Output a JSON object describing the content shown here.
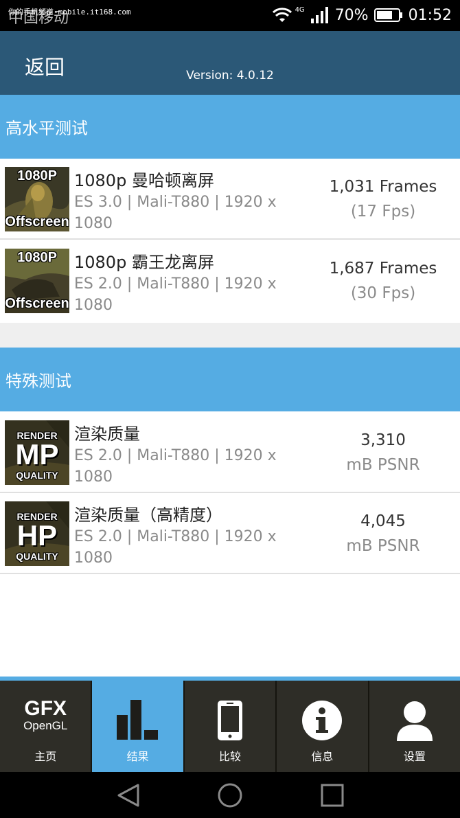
{
  "status_bar": {
    "carrier": "中国移动",
    "watermark": "你的手机频道-mobile.it168.com",
    "network": "4G",
    "battery": "70%",
    "time": "01:52"
  },
  "app_bar": {
    "back_label": "返回",
    "version": "Version: 4.0.12"
  },
  "sections": [
    {
      "title": "高水平测试",
      "rows": [
        {
          "thumb_top": "1080P",
          "thumb_bottom": "Offscreen",
          "title": "1080p 曼哈顿离屏",
          "desc": "ES 3.0 | Mali-T880 | 1920 x 1080",
          "score": "1,031 Frames",
          "sub": "(17 Fps)"
        },
        {
          "thumb_top": "1080P",
          "thumb_bottom": "Offscreen",
          "title": "1080p 霸王龙离屏",
          "desc": "ES 2.0 | Mali-T880 | 1920 x 1080",
          "score": "1,687 Frames",
          "sub": "(30 Fps)"
        }
      ]
    },
    {
      "title": "特殊测试",
      "rows": [
        {
          "thumb_top": "RENDER",
          "thumb_mid": "MP",
          "thumb_bottom": "QUALITY",
          "title": "渲染质量",
          "desc": "ES 2.0 | Mali-T880 | 1920 x 1080",
          "score": "3,310",
          "sub": "mB PSNR"
        },
        {
          "thumb_top": "RENDER",
          "thumb_mid": "HP",
          "thumb_bottom": "QUALITY",
          "title": "渲染质量（高精度）",
          "desc": "ES 2.0 | Mali-T880 | 1920 x 1080",
          "score": "4,045",
          "sub": "mB PSNR"
        }
      ]
    }
  ],
  "tabs": [
    {
      "label": "主页",
      "icon": "gfx-opengl-logo",
      "logo_line1": "GFX",
      "logo_line2": "OpenGL"
    },
    {
      "label": "结果",
      "icon": "bar-chart-icon",
      "active": true
    },
    {
      "label": "比较",
      "icon": "phone-icon"
    },
    {
      "label": "信息",
      "icon": "info-icon"
    },
    {
      "label": "设置",
      "icon": "user-icon"
    }
  ],
  "colors": {
    "app_bar": "#2b5877",
    "section_header": "#55ace3",
    "active_tab": "#55ace3",
    "tab_bg": "#2e2d27"
  }
}
